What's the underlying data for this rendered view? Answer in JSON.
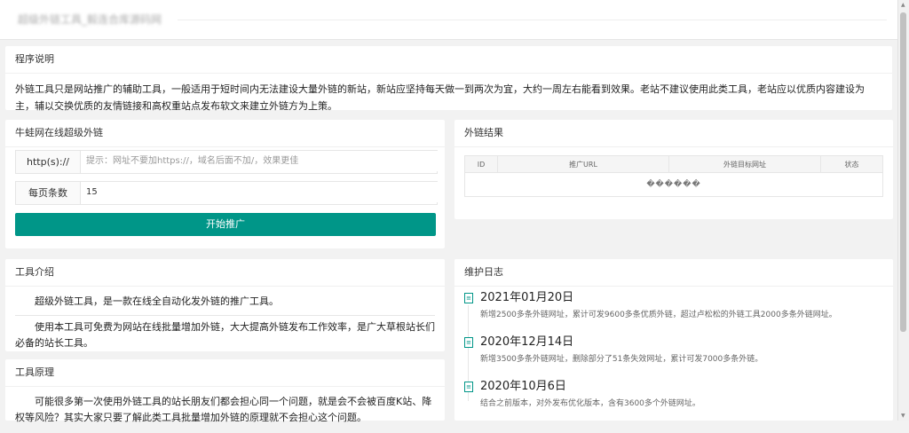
{
  "header": {
    "title": "超级外链工具_毅连合库源码网"
  },
  "intro": {
    "title": "程序说明",
    "text": "外链工具只是网站推广的辅助工具，一般适用于短时间内无法建设大量外链的新站，新站应坚持每天做一到两次为宜，大约一周左右能看到效果。老站不建议使用此类工具，老站应以优质内容建设为主，辅以交换优质的友情链接和高权重站点发布软文来建立外链方为上策。"
  },
  "form": {
    "title": "牛蛙网在线超级外链",
    "url_label": "http(s)://",
    "url_placeholder": "提示：网址不要加https://，域名后面不加/，效果更佳",
    "per_page_label": "每页条数",
    "per_page_value": "15",
    "submit_label": "开始推广"
  },
  "result": {
    "title": "外链结果",
    "columns": [
      "ID",
      "推广URL",
      "外链目标网址",
      "状态"
    ],
    "empty_text": "������"
  },
  "tool_intro": {
    "title": "工具介绍",
    "p1": "超级外链工具，是一款在线全自动化发外链的推广工具。",
    "p2": "使用本工具可免费为网站在线批量增加外链，大大提高外链发布工作效率，是广大草根站长们必备的站长工具。"
  },
  "principle": {
    "title": "工具原理",
    "p1": "可能很多第一次使用外链工具的站长朋友们都会担心同一个问题，就是会不会被百度K站、降权等风险？其实大家只要了解此类工具批量增加外链的原理就不会担心这个问题。"
  },
  "log": {
    "title": "维护日志",
    "items": [
      {
        "date": "2021年01月20日",
        "desc": "新增2500多条外链网址，累计可发9600多条优质外链，超过卢松松的外链工具2000多条外链网址。"
      },
      {
        "date": "2020年12月14日",
        "desc": "新增3500多条外链网址，删除部分了51条失效网址，累计可发7000多条外链。"
      },
      {
        "date": "2020年10月6日",
        "desc": "结合之前版本，对外发布优化版本，含有3600多个外链网址。"
      }
    ]
  },
  "colors": {
    "accent": "#009688",
    "background": "#f2f2f2"
  }
}
